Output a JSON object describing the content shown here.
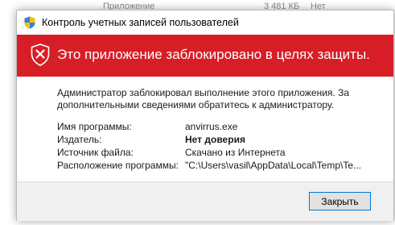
{
  "background": {
    "col_name": "Приложение",
    "col_size": "3 481 КБ",
    "col_status": "Нет"
  },
  "dialog": {
    "title": "Контроль учетных записей пользователей",
    "headline": "Это приложение заблокировано в целях защиты.",
    "message": "Администратор заблокировал выполнение этого приложения. За дополнительными сведениями обратитесь к администратору.",
    "details": [
      {
        "label": "Имя программы:",
        "value": "anvirrus.exe"
      },
      {
        "label": "Издатель:",
        "value": "Нет доверия"
      },
      {
        "label": "Источник файла:",
        "value": "Скачано из Интернета"
      },
      {
        "label": "Расположение программы:",
        "value": "\"C:\\Users\\vasil\\AppData\\Local\\Temp\\Te..."
      }
    ],
    "close_label": "Закрыть"
  },
  "colors": {
    "banner": "#d71e27",
    "button_border": "#0078d7"
  },
  "icons": {
    "title": "uac-shield-icon",
    "banner": "blocked-shield-x-icon"
  }
}
